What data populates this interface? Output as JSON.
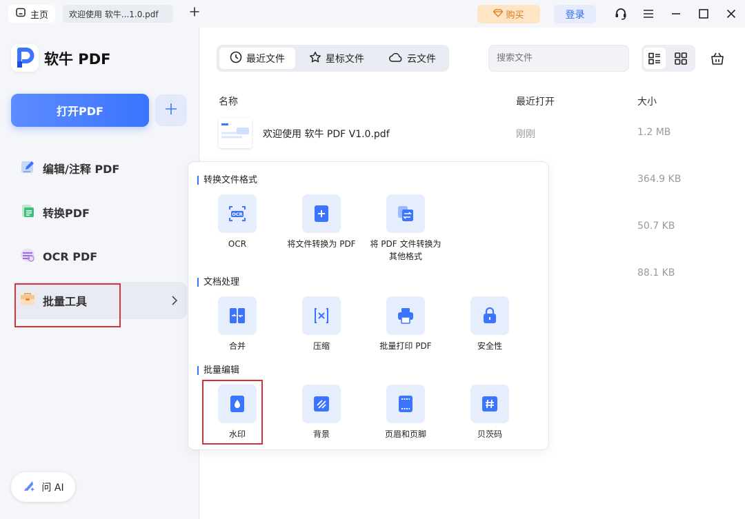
{
  "topbar": {
    "home_tab": "主页",
    "doc_tab": "欢迎使用 软牛...1.0.pdf",
    "new_tab_icon": "plus-icon",
    "buy_label": "购买",
    "login_label": "登录"
  },
  "sidebar": {
    "app_name": "软牛 PDF",
    "open_pdf": "打开PDF",
    "items": [
      {
        "label": "编辑/注释 PDF",
        "icon": "edit-icon"
      },
      {
        "label": "转换PDF",
        "icon": "convert-icon"
      },
      {
        "label": "OCR PDF",
        "icon": "ocr-icon"
      },
      {
        "label": "批量工具",
        "icon": "batch-toolbox-icon"
      }
    ],
    "ask_ai": "问 AI"
  },
  "main": {
    "tabs": [
      {
        "label": "最近文件",
        "icon": "clock-icon"
      },
      {
        "label": "星标文件",
        "icon": "star-icon"
      },
      {
        "label": "云文件",
        "icon": "cloud-icon"
      }
    ],
    "search_placeholder": "搜索文件",
    "columns": {
      "name": "名称",
      "opened": "最近打开",
      "size": "大小"
    },
    "files": [
      {
        "name": "欢迎使用 软牛 PDF V1.0.pdf",
        "opened": "刚刚",
        "size": "1.2 MB"
      },
      {
        "name": "",
        "opened": "",
        "size": "364.9 KB"
      },
      {
        "name": "",
        "opened": "",
        "size": "50.7 KB"
      },
      {
        "name": "",
        "opened": "",
        "size": "88.1 KB"
      }
    ]
  },
  "popup": {
    "convert_title": "转换文件格式",
    "convert": [
      {
        "label": "OCR",
        "icon": "ocr-icon"
      },
      {
        "label": "将文件转换为 PDF",
        "icon": "add-file-icon"
      },
      {
        "label": "将 PDF 文件转换为\n其他格式",
        "icon": "convert-file-icon"
      }
    ],
    "process_title": "文档处理",
    "process": [
      {
        "label": "合并",
        "icon": "merge-icon"
      },
      {
        "label": "压缩",
        "icon": "compress-icon"
      },
      {
        "label": "批量打印 PDF",
        "icon": "printer-icon"
      },
      {
        "label": "安全性",
        "icon": "lock-icon"
      }
    ],
    "edit_title": "批量编辑",
    "edit": [
      {
        "label": "水印",
        "icon": "watermark-icon"
      },
      {
        "label": "背景",
        "icon": "background-icon"
      },
      {
        "label": "页眉和页脚",
        "icon": "header-footer-icon"
      },
      {
        "label": "贝茨码",
        "icon": "bates-number-icon"
      }
    ]
  },
  "colors": {
    "accent": "#3a74ff",
    "highlight": "#d9313a",
    "buy": "#e07a1a"
  }
}
